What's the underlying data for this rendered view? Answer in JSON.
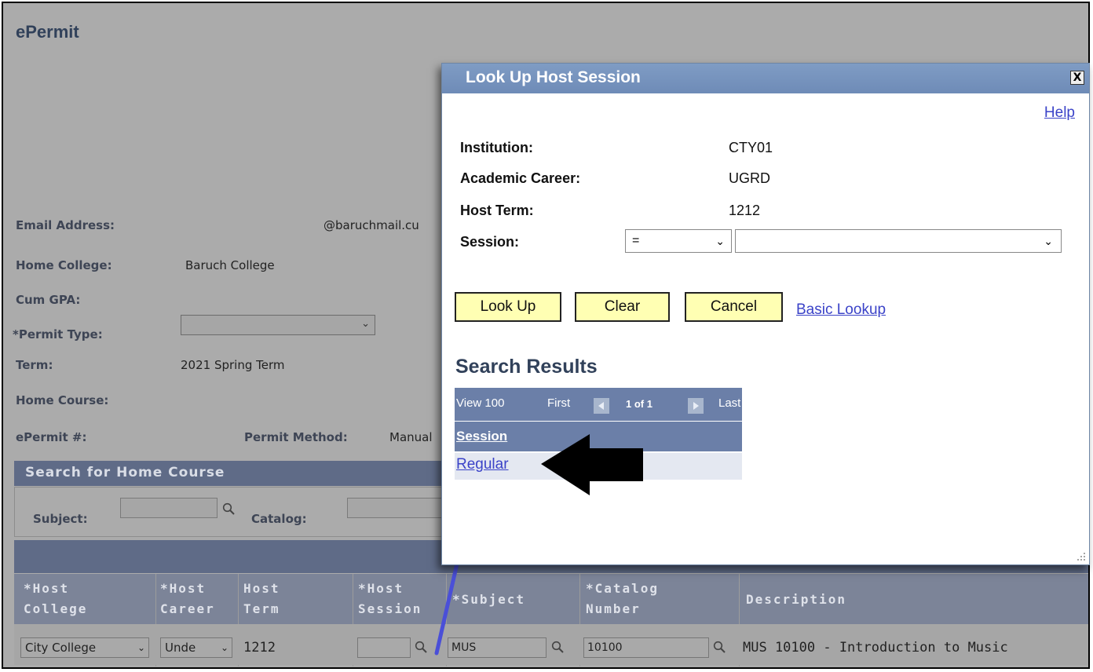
{
  "app": {
    "title": "ePermit"
  },
  "form": {
    "email_label": "Email Address:",
    "email_value": "@baruchmail.cu",
    "home_college_label": "Home College:",
    "home_college_value": "Baruch College",
    "cum_gpa_label": "Cum GPA:",
    "permit_type_label": "*Permit Type:",
    "permit_type_value": "",
    "term_label": "Term:",
    "term_value": "2021 Spring Term",
    "home_course_label": "Home Course:",
    "epermit_label": "ePermit #:",
    "permit_method_label": "Permit Method:",
    "permit_method_value": "Manual"
  },
  "search_home": {
    "title": "Search for Home Course",
    "subject_label": "Subject:",
    "catalog_label": "Catalog:"
  },
  "grid": {
    "columns": [
      {
        "line1": "*Host",
        "line2": "College"
      },
      {
        "line1": "*Host",
        "line2": "Career"
      },
      {
        "line1": "Host",
        "line2": "Term"
      },
      {
        "line1": "*Host",
        "line2": "Session"
      },
      {
        "line1": "*Subject",
        "line2": ""
      },
      {
        "line1": "*Catalog",
        "line2": "Number"
      },
      {
        "line1": "Description",
        "line2": ""
      }
    ],
    "row": {
      "host_college": "City College",
      "host_career": "Unde",
      "host_term": "1212",
      "host_session": "",
      "subject": "MUS",
      "catalog_number": "10100",
      "description": "MUS 10100 - Introduction to Music"
    }
  },
  "modal": {
    "title": "Look Up Host Session",
    "close_label": "X",
    "help_label": "Help",
    "institution_label": "Institution:",
    "institution_value": "CTY01",
    "career_label": "Academic Career:",
    "career_value": "UGRD",
    "host_term_label": "Host Term:",
    "host_term_value": "1212",
    "session_label": "Session:",
    "session_operator": "=",
    "session_value": "",
    "buttons": {
      "look_up": "Look Up",
      "clear": "Clear",
      "cancel": "Cancel",
      "basic_lookup": "Basic Lookup"
    },
    "search_results_title": "Search Results",
    "nav": {
      "view": "View 100",
      "first": "First",
      "page": "1 of 1",
      "last": "Last"
    },
    "results_header": "Session",
    "results": [
      "Regular"
    ]
  },
  "colors": {
    "overlay": "#ababab",
    "modal_titlebar": "#7592bd",
    "button_bg": "#ffffb3",
    "link": "#3b43c8",
    "grid_header": "#6b7fa8",
    "annotation_arrow": "#000000",
    "annotation_line": "#4a4fd8"
  },
  "icons": [
    "close-icon",
    "chevron-down-icon",
    "magnifier-icon",
    "first-page-icon",
    "next-page-icon",
    "resize-grip-icon",
    "annotation-arrow-icon"
  ]
}
